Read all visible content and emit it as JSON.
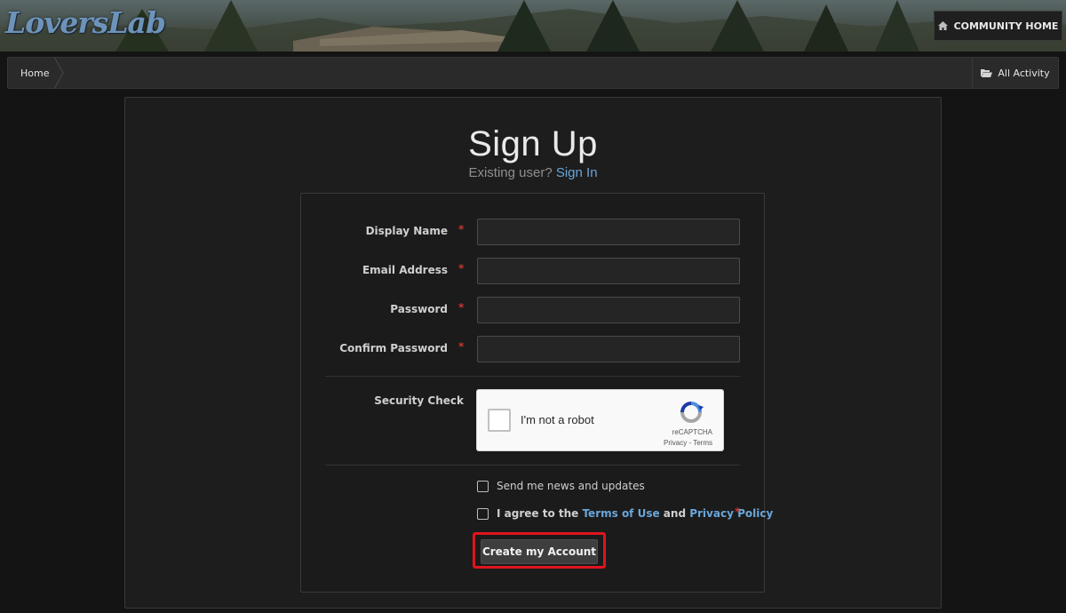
{
  "header": {
    "logo_text": "LoversLab",
    "community_home_label": "COMMUNITY HOME"
  },
  "breadcrumb": {
    "home_label": "Home",
    "all_activity_label": "All Activity"
  },
  "page": {
    "title": "Sign Up",
    "existing_user_text": "Existing user?",
    "sign_in_link": "Sign In"
  },
  "form": {
    "fields": [
      {
        "label": "Display Name",
        "required_mark": "*",
        "value": ""
      },
      {
        "label": "Email Address",
        "required_mark": "*",
        "value": ""
      },
      {
        "label": "Password",
        "required_mark": "*",
        "value": ""
      },
      {
        "label": "Confirm Password",
        "required_mark": "*",
        "value": ""
      }
    ],
    "security_check_label": "Security Check",
    "recaptcha": {
      "checkbox_label": "I'm not a robot",
      "brand": "reCAPTCHA",
      "privacy_link": "Privacy",
      "separator": " - ",
      "terms_link": "Terms"
    },
    "news_checkbox_label": "Send me news and updates",
    "agree": {
      "prefix": "I agree to the",
      "terms_link": "Terms of Use",
      "conjunction": "and",
      "privacy_link": "Privacy Policy",
      "required_mark": "*"
    },
    "submit_label": "Create my Account"
  },
  "colors": {
    "accent_link": "#6aa6d9",
    "required": "#d1312b",
    "highlight_border": "#e0141e"
  },
  "icons": [
    "home-icon",
    "folder-open-icon",
    "recaptcha-logo-icon"
  ]
}
